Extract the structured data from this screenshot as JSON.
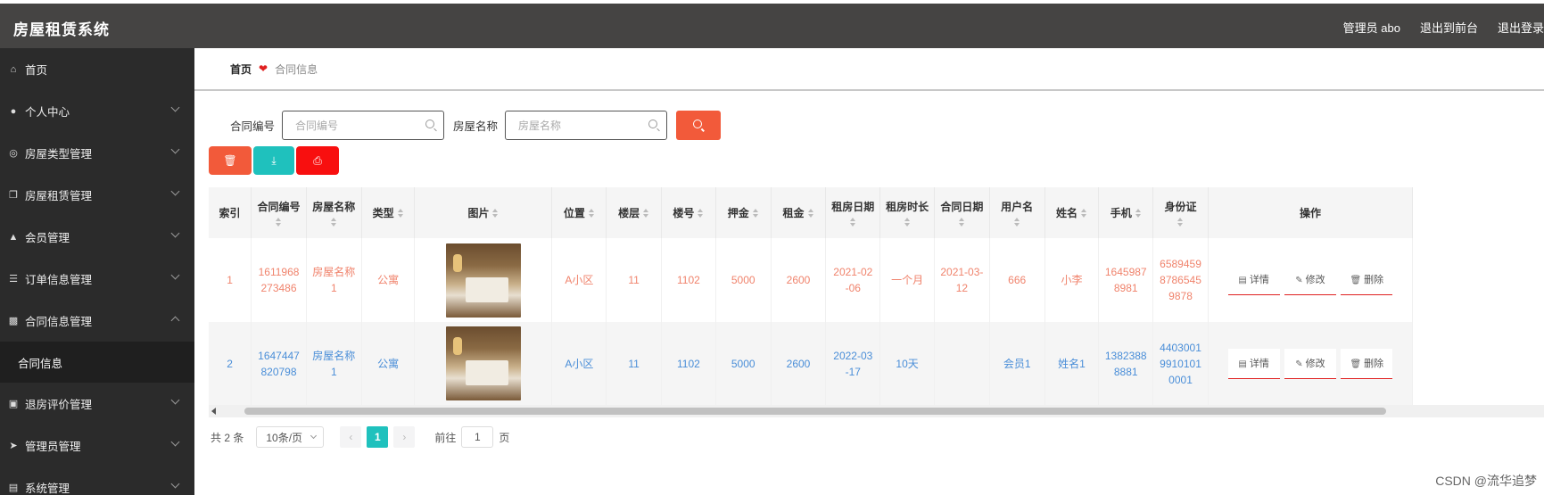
{
  "header": {
    "title": "房屋租赁系统",
    "admin": "管理员 abo",
    "to_front": "退出到前台",
    "logout": "退出登录"
  },
  "sidebar": {
    "items": [
      {
        "label": "首页",
        "icon": "home-icon",
        "chevron": false
      },
      {
        "label": "个人中心",
        "icon": "user-icon",
        "chevron": true
      },
      {
        "label": "房屋类型管理",
        "icon": "circle-icon",
        "chevron": true
      },
      {
        "label": "房屋租赁管理",
        "icon": "copy-icon",
        "chevron": true
      },
      {
        "label": "会员管理",
        "icon": "like-icon",
        "chevron": true
      },
      {
        "label": "订单信息管理",
        "icon": "list-icon",
        "chevron": true
      },
      {
        "label": "合同信息管理",
        "icon": "chart-icon",
        "chevron": true,
        "expanded": true
      },
      {
        "label": "退房评价管理",
        "icon": "monitor-icon",
        "chevron": true
      },
      {
        "label": "管理员管理",
        "icon": "send-icon",
        "chevron": true
      },
      {
        "label": "系统管理",
        "icon": "doc-icon",
        "chevron": true
      }
    ],
    "submenu": {
      "label": "合同信息"
    }
  },
  "breadcrumb": {
    "home": "首页",
    "current": "合同信息"
  },
  "search": {
    "contract_label": "合同编号",
    "contract_placeholder": "合同编号",
    "house_label": "房屋名称",
    "house_placeholder": "房屋名称"
  },
  "table": {
    "columns": [
      "索引",
      "合同编号",
      "房屋名称",
      "类型",
      "图片",
      "位置",
      "楼层",
      "楼号",
      "押金",
      "租金",
      "租房日期",
      "租房时长",
      "合同日期",
      "用户名",
      "姓名",
      "手机",
      "身份证",
      "操作"
    ],
    "rows": [
      {
        "index": "1",
        "contract_no": "1611968273486",
        "house_name": "房屋名称1",
        "type": "公寓",
        "location": "A小区",
        "floor": "11",
        "building": "1102",
        "deposit": "5000",
        "rent": "2600",
        "rent_date": "2021-02-06",
        "duration": "一个月",
        "contract_date": "2021-03-12",
        "username": "666",
        "name": "小李",
        "phone": "16459878981",
        "id_card": "658945987865459878"
      },
      {
        "index": "2",
        "contract_no": "1647447820798",
        "house_name": "房屋名称1",
        "type": "公寓",
        "location": "A小区",
        "floor": "11",
        "building": "1102",
        "deposit": "5000",
        "rent": "2600",
        "rent_date": "2022-03-17",
        "duration": "10天",
        "contract_date": "",
        "username": "会员1",
        "name": "姓名1",
        "phone": "13823888881",
        "id_card": "440300199101010001"
      }
    ],
    "ops": {
      "detail": "详情",
      "edit": "修改",
      "delete": "删除"
    }
  },
  "pagination": {
    "total": "共 2 条",
    "page_size": "10条/页",
    "current_page": "1",
    "goto_label": "前往",
    "goto_value": "1",
    "page_unit": "页"
  },
  "watermark": "CSDN @流华追梦",
  "colors": {
    "topbar": "#454443",
    "sidebar": "#2b2b2b",
    "search_button": "#f25a3a",
    "export_button": "#1fc1bd",
    "print_button": "#f80f0f",
    "row1_text": "#f0836c",
    "row2_text": "#4a8ed8"
  }
}
